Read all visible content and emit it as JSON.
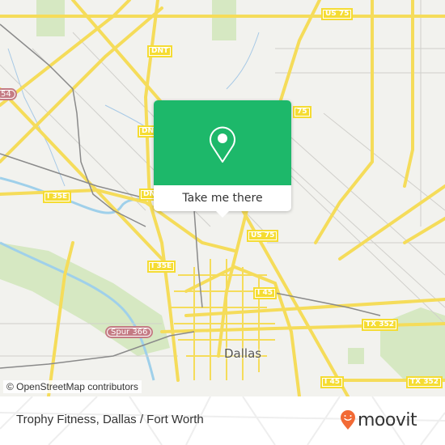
{
  "map": {
    "attribution": "© OpenStreetMap contributors",
    "city_label": "Dallas",
    "road_shields": [
      {
        "label": "US 75",
        "type": "yellow"
      },
      {
        "label": "DNT",
        "type": "yellow"
      },
      {
        "label": "DNT",
        "type": "yellow"
      },
      {
        "label": "DNT",
        "type": "yellow"
      },
      {
        "label": "75",
        "type": "yellow"
      },
      {
        "label": "I 35E",
        "type": "yellow"
      },
      {
        "label": "US 75",
        "type": "yellow"
      },
      {
        "label": "I 35E",
        "type": "yellow"
      },
      {
        "label": "I 45",
        "type": "yellow"
      },
      {
        "label": "Spur 366",
        "type": "red"
      },
      {
        "label": "TX 352",
        "type": "yellow"
      },
      {
        "label": "I 45",
        "type": "yellow"
      },
      {
        "label": "TX 352",
        "type": "yellow"
      },
      {
        "label": "54",
        "type": "red"
      }
    ]
  },
  "popup": {
    "cta_label": "Take me there",
    "icon": "map-pin-icon",
    "accent_color": "#1db86a"
  },
  "footer": {
    "place_title": "Trophy Fitness, Dallas / Fort Worth",
    "logo_text": "moovit",
    "logo_color": "#f26a35"
  }
}
